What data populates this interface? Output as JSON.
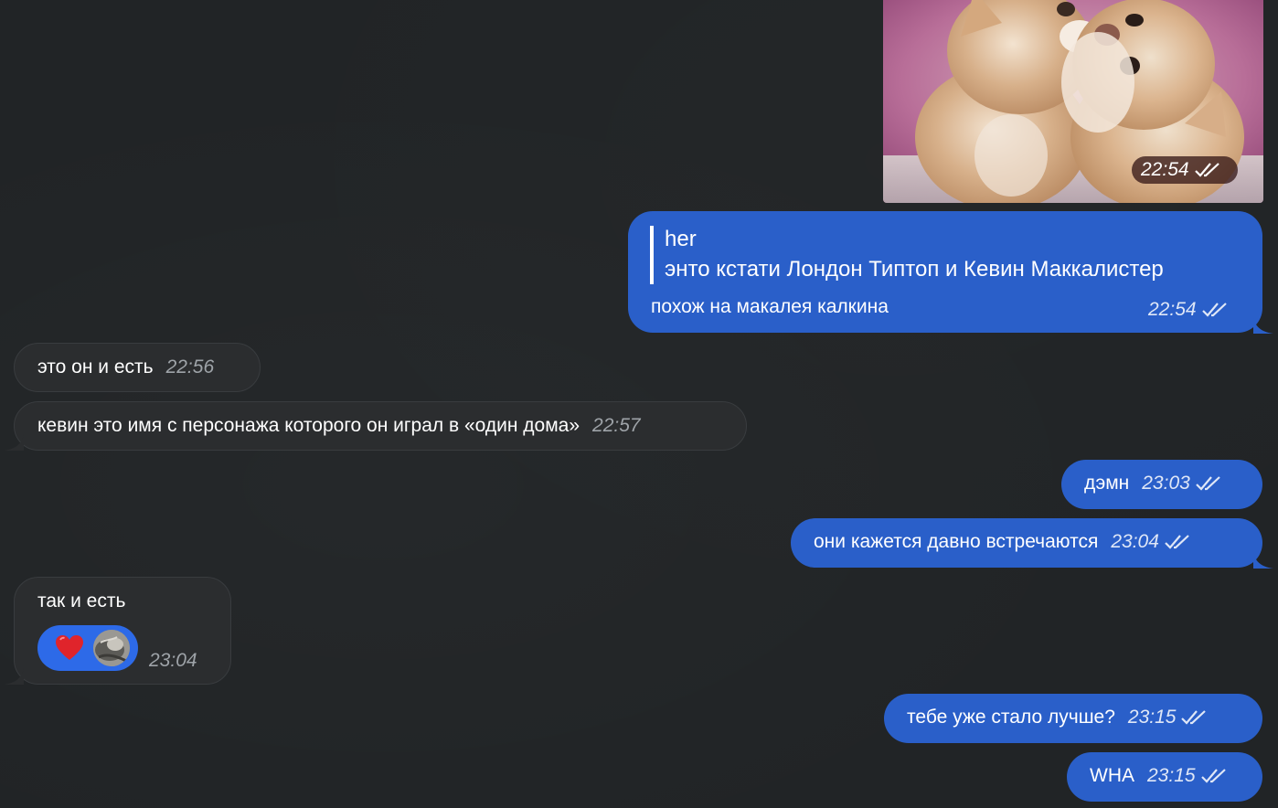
{
  "messages": {
    "kittens_time": "22:54",
    "reply": {
      "quote_author": "her",
      "quote_text": "энто кстати Лондон Типтоп и Кевин Маккалистер",
      "text": "похож на макалея калкина",
      "time": "22:54"
    },
    "m1": {
      "text": "это он и есть",
      "time": "22:56"
    },
    "m2": {
      "text": "кевин это имя с персонажа которого он играл в «один дома»",
      "time": "22:57"
    },
    "m3": {
      "text": "дэмн",
      "time": "23:03"
    },
    "m4": {
      "text": "они кажется давно встречаются",
      "time": "23:04"
    },
    "m5": {
      "text": "так и есть",
      "time": "23:04",
      "reaction_icon": "heart-icon"
    },
    "m6": {
      "text": "тебе уже стало лучше?",
      "time": "23:15"
    },
    "m7": {
      "text": "WHA",
      "time": "23:15"
    }
  },
  "colors": {
    "background": "#212426",
    "incoming_bubble": "#2b2d2f",
    "outgoing_bubble": "#2a5fc9"
  }
}
